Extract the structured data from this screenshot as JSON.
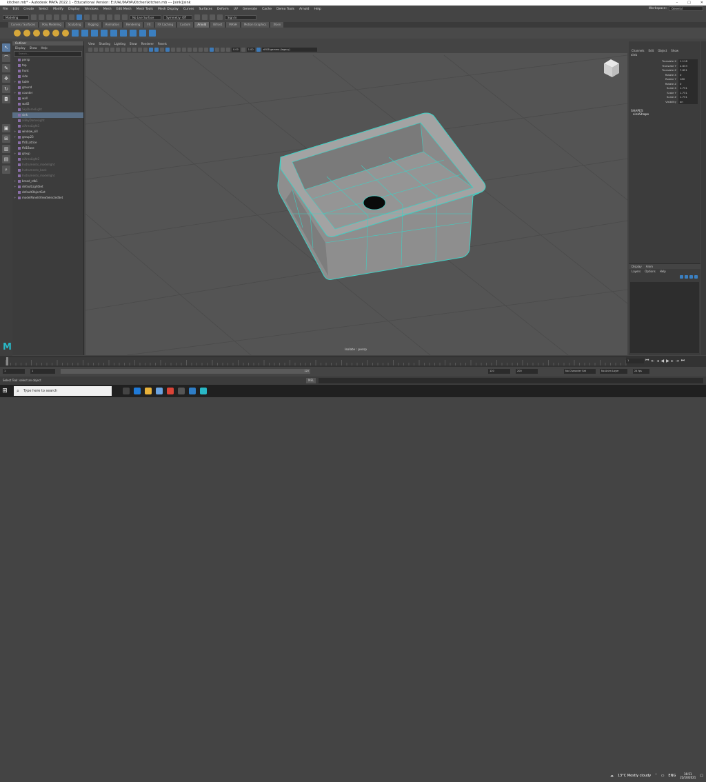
{
  "window": {
    "title": "kitchen.mb* - Autodesk MAYA 2022.1 - Educational Version: E:\\UAL\\MAYA\\Kitchen\\kitchen.mb  ---  [sink]|sink",
    "controls": [
      "–",
      "□",
      "✕"
    ]
  },
  "menubar": {
    "items": [
      "File",
      "Edit",
      "Create",
      "Select",
      "Modify",
      "Display",
      "Windows",
      "Mesh",
      "Edit Mesh",
      "Mesh Tools",
      "Mesh Display",
      "Curves",
      "Surfaces",
      "Deform",
      "UV",
      "Generate",
      "Cache",
      "Demo Tools",
      "Arnold",
      "Help"
    ],
    "workspace_label": "Workspace:",
    "workspace_value": "General"
  },
  "statusline": {
    "mode": "Modeling",
    "live_surface": "No Live Surface",
    "symmetry": "Symmetry: Off",
    "sign_in": "Sign In"
  },
  "shelf_tabs": [
    "Curves / Surfaces",
    "Poly Modeling",
    "Sculpting",
    "Rigging",
    "Animation",
    "Rendering",
    "FX",
    "FX Caching",
    "Custom",
    "Arnold",
    "Bifrost",
    "MASH",
    "Motion Graphics",
    "XGen"
  ],
  "shelf_active": "Arnold",
  "outliner": {
    "title": "Outliner",
    "menu": [
      "Display",
      "Show",
      "Help"
    ],
    "search_placeholder": "Search...",
    "rows": [
      {
        "label": "persp",
        "state": "normal"
      },
      {
        "label": "top",
        "state": "normal"
      },
      {
        "label": "front",
        "state": "normal"
      },
      {
        "label": "side",
        "state": "normal"
      },
      {
        "label": "table",
        "state": "group"
      },
      {
        "label": "ground",
        "state": "normal"
      },
      {
        "label": "counter",
        "state": "group"
      },
      {
        "label": "wall",
        "state": "normal"
      },
      {
        "label": "wall2",
        "state": "normal"
      },
      {
        "label": "SkyDomeLight",
        "state": "dim"
      },
      {
        "label": "sink",
        "state": "selected"
      },
      {
        "label": "aiSkyDomeLight",
        "state": "dim"
      },
      {
        "label": "aiAreaLight1",
        "state": "dim"
      },
      {
        "label": "window_sill",
        "state": "group"
      },
      {
        "label": "group23",
        "state": "group"
      },
      {
        "label": "ffd1Lattice",
        "state": "normal"
      },
      {
        "label": "ffd1Base",
        "state": "normal"
      },
      {
        "label": "group",
        "state": "group"
      },
      {
        "label": "aiAreaLight2",
        "state": "dim"
      },
      {
        "label": "Instruments_modellight",
        "state": "dim"
      },
      {
        "label": "Instruments_back",
        "state": "dim"
      },
      {
        "label": "Instruments_modellight",
        "state": "dim"
      },
      {
        "label": "bread_rdb1",
        "state": "group"
      },
      {
        "label": "defaultLightSet",
        "state": "group"
      },
      {
        "label": "defaultObjectSet",
        "state": "normal"
      },
      {
        "label": "modelPanel4ViewSelectedSet",
        "state": "group"
      }
    ]
  },
  "viewport": {
    "menu": [
      "View",
      "Shading",
      "Lighting",
      "Show",
      "Renderer",
      "Panels"
    ],
    "field_a": "0.00",
    "field_b": "1.00",
    "color_space": "sRGB gamma (legacy)",
    "isolate_label": "Isolate : persp"
  },
  "channel_box": {
    "menu": [
      "Channels",
      "Edit",
      "Object",
      "Show"
    ],
    "object": "sink",
    "attributes": [
      {
        "name": "Translate X",
        "value": "1.118"
      },
      {
        "name": "Translate Y",
        "value": "2.633"
      },
      {
        "name": "Translate Z",
        "value": "7.851"
      },
      {
        "name": "Rotate X",
        "value": "0"
      },
      {
        "name": "Rotate Y",
        "value": "180"
      },
      {
        "name": "Rotate Z",
        "value": "0"
      },
      {
        "name": "Scale X",
        "value": "1.731"
      },
      {
        "name": "Scale Y",
        "value": "1.731"
      },
      {
        "name": "Scale Z",
        "value": "1.731"
      },
      {
        "name": "Visibility",
        "value": "on"
      }
    ],
    "shapes_label": "SHAPES",
    "shape_name": "sinkShape"
  },
  "layer_editor": {
    "tabs": [
      "Display",
      "Anim"
    ],
    "menu": [
      "Layers",
      "Options",
      "Help"
    ]
  },
  "timeline": {
    "current_frame": "1",
    "start": "1",
    "range_start": "1",
    "range_end": "120",
    "range_end2": "120",
    "max": "200",
    "character_set": "No Character Set",
    "anim_layer": "No Anim Layer",
    "fps": "24 fps"
  },
  "cmdline": {
    "help": "Select Tool: select an object",
    "lang": "MEL"
  },
  "taskbar": {
    "search": "Type here to search",
    "weather": "13°C  Mostly cloudy",
    "lang": "ENG",
    "time": "16:51",
    "date": "22/10/2021"
  },
  "logo": "M",
  "colors": {
    "wire": "#3fd0c4",
    "sink": "#9b9b9b",
    "viewport_bg": "#545454"
  }
}
